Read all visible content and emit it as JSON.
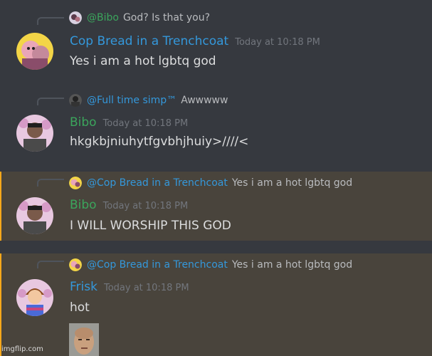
{
  "colors": {
    "background": "#36393f",
    "mention_background": "#49443c",
    "mention_bar": "#faa81a",
    "timestamp": "#72767d",
    "message_text": "#dcddde",
    "reply_text": "#b9bbbe"
  },
  "messages": [
    {
      "reply": {
        "avatar_icon": "avatar-icon",
        "mention": "@Bibo",
        "mention_color": "#3ba55c",
        "text": "God? Is that you?"
      },
      "author": {
        "name": "Cop Bread in a Trenchcoat",
        "color": "#3498db",
        "avatar_icon": "avatar-icon"
      },
      "timestamp": "Today at 10:18 PM",
      "content": "Yes i am a hot lgbtq god",
      "highlighted": false
    },
    {
      "reply": {
        "avatar_icon": "avatar-icon",
        "mention": "@Full time simp™",
        "mention_color": "#3498db",
        "text": "Awwwww"
      },
      "author": {
        "name": "Bibo",
        "color": "#3ba55c",
        "avatar_icon": "avatar-icon"
      },
      "timestamp": "Today at 10:18 PM",
      "content": "hkgkbjniuhytfgvbhjhuiy>////<",
      "highlighted": false
    },
    {
      "reply": {
        "avatar_icon": "avatar-icon",
        "mention": "@Cop Bread in a Trenchcoat",
        "mention_color": "#3498db",
        "text": "Yes i am a hot lgbtq god"
      },
      "author": {
        "name": "Bibo",
        "color": "#3ba55c",
        "avatar_icon": "avatar-icon"
      },
      "timestamp": "Today at 10:18 PM",
      "content": "I WILL WORSHIP THIS GOD",
      "highlighted": true
    },
    {
      "reply": {
        "avatar_icon": "avatar-icon",
        "mention": "@Cop Bread in a Trenchcoat",
        "mention_color": "#3498db",
        "text": "Yes i am a hot lgbtq god"
      },
      "author": {
        "name": "Frisk",
        "color": "#3498db",
        "avatar_icon": "avatar-icon"
      },
      "timestamp": "Today at 10:18 PM",
      "content": "hot",
      "highlighted": true,
      "attachment_icon": "sticker-image"
    }
  ],
  "watermark": "imgflip.com"
}
